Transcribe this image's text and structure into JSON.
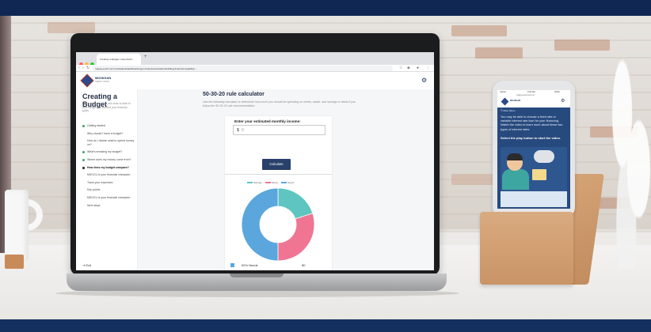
{
  "colors": {
    "brand_navy": "#1e2f5a",
    "button": "#28406a",
    "savings": "#5ec5c1",
    "wants": "#f07593",
    "needs": "#5ba7dd",
    "phone_panel": "#274a7e"
  },
  "browser": {
    "tab_title": "Creating a Budget | How Much...",
    "url": "mappy.everfi-next.net/student/dashboard/mgcu-financial-education/building-financial-capability/..."
  },
  "brand": {
    "name": "MICHIGAN",
    "sub": "CREDIT UNION",
    "logo_icon": "diamond-logo-icon"
  },
  "sidebar": {
    "title": "Creating a Budget",
    "description": "Learn strategies, tips, and tools to stick to your budget and achieve your financial goals.",
    "items": [
      {
        "label": "Getting started",
        "bullet": "#3aa56b"
      },
      {
        "label": "Why should I have a budget?",
        "bullet": "none"
      },
      {
        "label": "How do I decide what to spend money on?",
        "bullet": "none"
      },
      {
        "label": "What's breaking my budget?",
        "bullet": "#3aa56b"
      },
      {
        "label": "Where does my money come from?",
        "bullet": "#3aa56b"
      },
      {
        "label": "How does my budget compare?",
        "bullet": "#222222"
      },
      {
        "label": "MSGCU is your financial champion.",
        "bullet": "none"
      },
      {
        "label": "Track your expenses",
        "bullet": "none"
      },
      {
        "label": "Key points",
        "bullet": "none"
      },
      {
        "label": "MSGCU is your financial champion.",
        "bullet": "none"
      },
      {
        "label": "Next steps",
        "bullet": "none"
      }
    ],
    "exit_label": "Exit"
  },
  "main": {
    "title": "50-30-20 rule calculator",
    "description": "Use the following calculator to determine how much you should be spending on needs, wants, and savings or debts if you follow the 50-30-20 rule recommendation."
  },
  "calculator": {
    "income_label": "Enter your estimated monthly income:",
    "currency": "$",
    "income_value": "0",
    "button_label": "Calculate",
    "legend": [
      "Savings",
      "Wants",
      "Needs"
    ],
    "result_label": "50% Needs",
    "result_value": "$0"
  },
  "chart_data": {
    "type": "pie",
    "categories": [
      "Savings",
      "Wants",
      "Needs"
    ],
    "values": [
      20,
      30,
      50
    ],
    "legend_position": "top"
  },
  "phone": {
    "carrier": "Carrier",
    "time": "9:41 AM",
    "battery": "100%",
    "url": "mappy.everfi-next.net",
    "menu_label": "Main Menu",
    "body": "You may be able to choose a fixed rate or variable interest rate loan for your financing. Watch the video to learn more about these two types of interest rates.",
    "instruction": "Select the play button to start the video."
  }
}
